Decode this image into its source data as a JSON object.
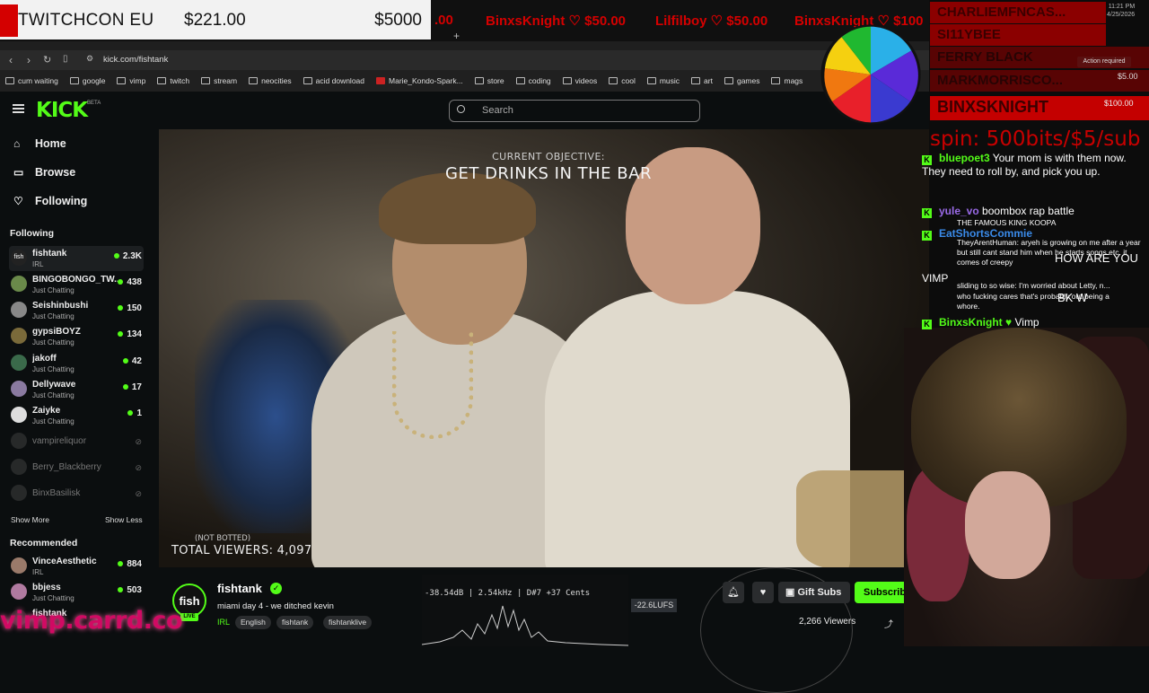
{
  "overlay": {
    "goal_name": "TWITCHCON EU",
    "goal_current": "$221.00",
    "goal_target": "$5000",
    "ticker": [
      {
        "name": "BinxsKnight",
        "amount": "$50.00"
      },
      {
        "name": "Lilfilboy",
        "amount": "$50.00"
      },
      {
        "name": "BinxsKnight",
        "amount": "$100"
      }
    ],
    "ticker_prefix_amount": ".00",
    "donors": [
      "CHARLIEMFNCAS...",
      "SI11YBEE",
      "FERRY BLACK",
      "MARKMORRISCO...",
      "BINXSKNIGHT"
    ],
    "donor_amounts": [
      "$5.00",
      "$100.00"
    ],
    "spin_text": "spin: 500bits/$5/sub",
    "clock_time": "11:21 PM",
    "clock_date": "4/25/2026",
    "carrd": "vimp.carrd.co",
    "action_required": "Action required"
  },
  "browser": {
    "url": "kick.com/fishtank",
    "bookmarks": [
      "cum waiting",
      "google",
      "vimp",
      "twitch",
      "stream",
      "neocities",
      "acid download",
      "Marie_Kondo-Spark...",
      "store",
      "coding",
      "videos",
      "cool",
      "music",
      "art",
      "games",
      "mags"
    ]
  },
  "kick": {
    "logo": "KICK",
    "beta": "BETA",
    "search_placeholder": "Search",
    "nav": [
      {
        "label": "Home",
        "icon": "home-icon"
      },
      {
        "label": "Browse",
        "icon": "browse-icon"
      },
      {
        "label": "Following",
        "icon": "heart-icon"
      }
    ],
    "following_title": "Following",
    "following": [
      {
        "name": "fishtank",
        "category": "IRL",
        "viewers": "2.3K"
      },
      {
        "name": "BINGOBONGO_TW...",
        "category": "Just Chatting",
        "viewers": "438"
      },
      {
        "name": "Seishinbushi",
        "category": "Just Chatting",
        "viewers": "150"
      },
      {
        "name": "gypsiBOYZ",
        "category": "Just Chatting",
        "viewers": "134"
      },
      {
        "name": "jakoff",
        "category": "Just Chatting",
        "viewers": "42"
      },
      {
        "name": "Dellywave",
        "category": "Just Chatting",
        "viewers": "17"
      },
      {
        "name": "Zaiyke",
        "category": "Just Chatting",
        "viewers": "1"
      }
    ],
    "offline": [
      "vampireliquor",
      "Berry_Blackberry",
      "BinxBasilisk"
    ],
    "show_more": "Show More",
    "show_less": "Show Less",
    "recommended_title": "Recommended",
    "recommended": [
      {
        "name": "VinceAesthetic",
        "category": "IRL",
        "viewers": "884"
      },
      {
        "name": "bbjess",
        "category": "Just Chatting",
        "viewers": "503"
      },
      {
        "name": "fishtank",
        "category": "",
        "viewers": ""
      }
    ]
  },
  "video": {
    "objective_label": "CURRENT OBJECTIVE:",
    "objective": "GET DRINKS IN THE BAR",
    "not_botted": "(NOT BOTTED)",
    "total_viewers": "TOTAL VIEWERS: 4,097"
  },
  "stream": {
    "channel": "fishtank",
    "title": "miami day 4 - we ditched kevin",
    "category": "IRL",
    "tags": [
      "English",
      "fishtank",
      "fishtanklive"
    ],
    "gift_subs": "Gift Subs",
    "subscribe": "Subscribe",
    "viewers": "2,266 Viewers",
    "live": "LIVE"
  },
  "audio": {
    "readout": "-38.54dB | 2.54kHz | D#7 +37 Cents",
    "lufs": "-22.6LUFS"
  },
  "chat": [
    {
      "user": "bluepoet3",
      "text": "Your mom is with them now. They need to roll by, and pick you up."
    },
    {
      "user": "yule_vo",
      "text": "boombox rap battle"
    },
    {
      "user": "EatShortsCommie",
      "text": ""
    },
    {
      "user": "VIMP",
      "text": ""
    },
    {
      "user": "BinxsKnight",
      "text": "Vimp"
    }
  ],
  "chat_small": [
    "THE FAMOUS KING KOOPA",
    "TheyArentHuman: aryeh is growing on me after a year but still cant stand him when he starts songs etc. it comes of creepy",
    "HOW ARE YOU",
    "sliding to so wise: I'm worried about Letty, n...",
    "BK W",
    "who fucking cares that's probably out being a whore."
  ],
  "colors": {
    "kick_green": "#53fc18",
    "donation_red": "#d50000",
    "carrd_pink": "#d10a63"
  }
}
